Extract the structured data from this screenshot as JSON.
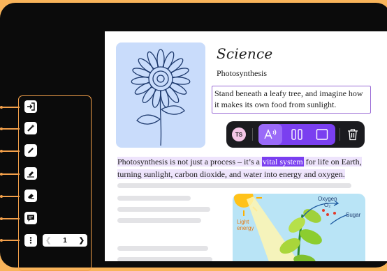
{
  "lesson": {
    "title": "Science",
    "subtitle": "Photosynthesis",
    "quote": "Stand beneath a leafy tree, and imagine how it makes its own food from sunlight.",
    "paragraph": {
      "before": "Photosynthesis is not just a process – it’s a ",
      "highlight": "vital system",
      "after": " for life on Earth, turning sunlight, carbon dioxide, and water into energy and oxygen."
    }
  },
  "diagram": {
    "labels": {
      "light": "Light energy",
      "oxygen": "Oxygen",
      "o2": "O₂",
      "sugar": "Sugar"
    }
  },
  "toolbar": {
    "avatar_initials": "TS",
    "icons": [
      "read-aloud-icon",
      "columns-icon",
      "frame-icon",
      "trash-icon"
    ]
  },
  "sidebar": {
    "icons": [
      "exit-icon",
      "wand-icon",
      "pencil-icon",
      "highlighter-icon",
      "eraser-icon",
      "comment-icon",
      "more-icon"
    ],
    "page_number": "1"
  },
  "colors": {
    "accent": "#7a3ff0",
    "accent_light": "#9a6af8",
    "highlight_bg": "#eee4fc",
    "frame_orange": "#f3a04a",
    "hero_bg": "#c9dcfb"
  }
}
